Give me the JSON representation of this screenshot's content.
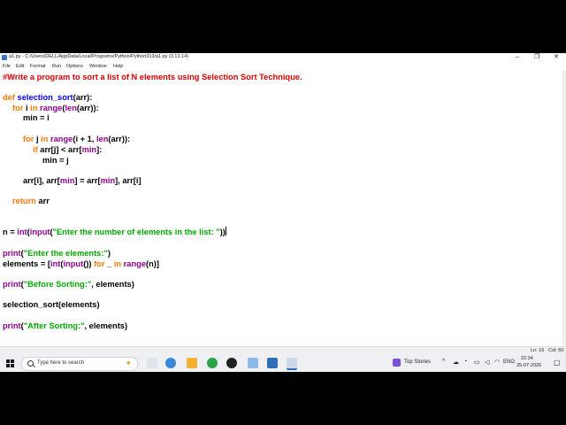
{
  "window": {
    "title": "a1.py - C:/Users/DELL/AppData/Local/Programs/Python/Python313/a1.py (3.13.14)",
    "minimize": "–",
    "maximize": "❐",
    "close": "✕"
  },
  "menu": [
    "File",
    "Edit",
    "Format",
    "Run",
    "Options",
    "Window",
    "Help"
  ],
  "code": {
    "l1": "#Write a program to sort a list of N elements using Selection Sort Technique.",
    "l2_def": "def",
    "l2_name": "selection_sort",
    "l2_rest": "(arr):",
    "l3_for": "for",
    "l3_i": " i ",
    "l3_in": "in",
    "l3_range": "range",
    "l3_p": "(",
    "l3_len": "len",
    "l3_rest": "(arr)):",
    "l4": "min = i",
    "l5_for": "for",
    "l5_j": " j ",
    "l5_in": "in",
    "l5_range": "range",
    "l5_mid": "(i + 1, ",
    "l5_len": "len",
    "l5_rest": "(arr)):",
    "l6_if": "if",
    "l6_rest": " arr[j] < arr[",
    "l6_min": "min",
    "l6_end": "]:",
    "l7": "min = j",
    "l8_a": "arr[i], arr[",
    "l8_min1": "min",
    "l8_b": "] = arr[",
    "l8_min2": "min",
    "l8_c": "], arr[i]",
    "l9_ret": "return",
    "l9_rest": " arr",
    "l10_a": "n = ",
    "l10_int": "int",
    "l10_p": "(",
    "l10_input": "input",
    "l10_p2": "(",
    "l10_str": "\"Enter the number of elements in the list: \"",
    "l10_end": "))",
    "l11_print": "print",
    "l11_p": "(",
    "l11_str": "\"Enter the elements:\"",
    "l11_end": ")",
    "l12_a": "elements = [",
    "l12_int": "int",
    "l12_p": "(",
    "l12_input": "input",
    "l12_b": "()) ",
    "l12_for": "for",
    "l12_c": " _ ",
    "l12_in": "in",
    "l12_sp": " ",
    "l12_range": "range",
    "l12_d": "(n)]",
    "l13_print": "print",
    "l13_p": "(",
    "l13_str": "\"Before Sorting:\"",
    "l13_end": ", elements)",
    "l14": "selection_sort(elements)",
    "l15_print": "print",
    "l15_p": "(",
    "l15_str": "\"After Sorting:\"",
    "l15_end": ", elements)"
  },
  "status": {
    "line": "Ln: 16",
    "col": "Col: 60"
  },
  "taskbar": {
    "search_placeholder": "Type here to search",
    "weather": "Top Stories",
    "lang": "ENG",
    "time": "22:34",
    "date": "25-07-2026"
  },
  "colors": {
    "keyword": "#ff7700",
    "builtin": "#900090",
    "string": "#00aa00",
    "comment": "#dd0000",
    "defname": "#0000ff"
  }
}
